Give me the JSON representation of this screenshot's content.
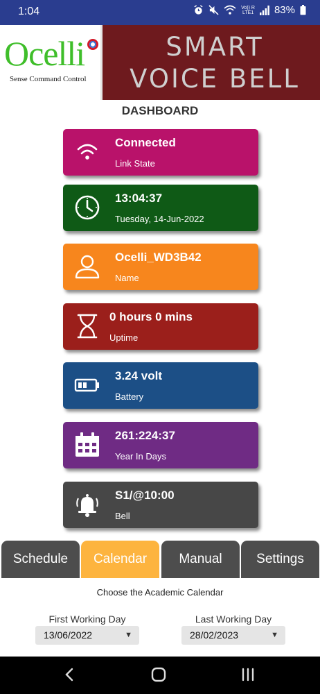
{
  "status_bar": {
    "time": "1:04",
    "volte": "Vo)) R",
    "lte": "LTE1",
    "battery_percent": "83%",
    "icons": [
      "alarm-icon",
      "mute-icon",
      "wifi-icon",
      "volte-lte-icon",
      "signal-icon",
      "battery-icon"
    ]
  },
  "header": {
    "logo_text": "Ocelli",
    "logo_tagline": "Sense Command Control",
    "title_line1": "SMART",
    "title_line2": "VOICE BELL"
  },
  "dashboard": {
    "title": "DASHBOARD",
    "cards": [
      {
        "value": "Connected",
        "label": "Link State",
        "icon": "wifi-icon",
        "color": "#b9126a"
      },
      {
        "value": "13:04:37",
        "label": "Tuesday, 14-Jun-2022",
        "icon": "clock-icon",
        "color": "#0f5a16"
      },
      {
        "value": "Ocelli_WD3B42",
        "label": "Name",
        "icon": "user-icon",
        "color": "#f7861d"
      },
      {
        "value": "0 hours 0 mins",
        "label": "Uptime",
        "icon": "hourglass-icon",
        "color": "#9b1f1b"
      },
      {
        "value": "3.24 volt",
        "label": "Battery",
        "icon": "battery-icon",
        "color": "#1c4f86"
      },
      {
        "value": "261:224:37",
        "label": "Year In Days",
        "icon": "calendar-icon",
        "color": "#6f2b84"
      },
      {
        "value": "S1/@10:00",
        "label": "Bell",
        "icon": "bell-ringing-icon",
        "color": "#474747"
      }
    ]
  },
  "tabs": [
    {
      "label": "Schedule",
      "active": false
    },
    {
      "label": "Calendar",
      "active": true
    },
    {
      "label": "Manual",
      "active": false
    },
    {
      "label": "Settings",
      "active": false
    }
  ],
  "calendar": {
    "caption": "Choose the Academic Calendar",
    "first_day_label": "First Working Day",
    "first_day_value": "13/06/2022",
    "last_day_label": "Last Working Day",
    "last_day_value": "28/02/2023"
  },
  "nav": {
    "icons": [
      "back-icon",
      "home-icon",
      "recents-icon"
    ]
  },
  "colors": {
    "status_bar": "#2a3d8f",
    "header_bg": "#6e1a1e",
    "tab_inactive": "#4d4d4d",
    "tab_active": "#fdb43f"
  }
}
